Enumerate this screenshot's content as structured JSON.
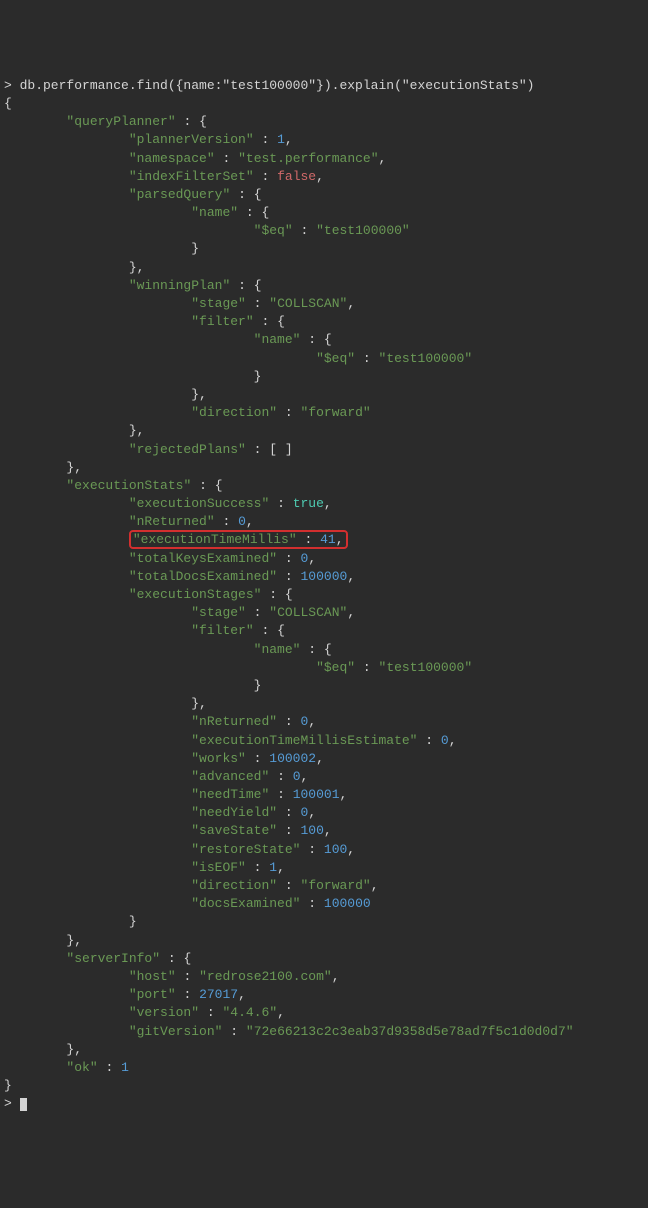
{
  "command_line": "> db.performance.find({name:\"test100000\"}).explain(\"executionStats\")",
  "queryPlanner": {
    "plannerVersion": 1,
    "namespace": "test.performance",
    "indexFilterSet": "false",
    "parsedQuery": {
      "name": {
        "$eq": "test100000"
      }
    },
    "winningPlan": {
      "stage": "COLLSCAN",
      "filter": {
        "name": {
          "$eq": "test100000"
        }
      },
      "direction": "forward"
    },
    "rejectedPlans": "[ ]"
  },
  "executionStats": {
    "executionSuccess": "true",
    "nReturned": 0,
    "executionTimeMillis": 41,
    "totalKeysExamined": 0,
    "totalDocsExamined": 100000,
    "executionStages": {
      "stage": "COLLSCAN",
      "filter": {
        "name": {
          "$eq": "test100000"
        }
      },
      "nReturned": 0,
      "executionTimeMillisEstimate": 0,
      "works": 100002,
      "advanced": 0,
      "needTime": 100001,
      "needYield": 0,
      "saveState": 100,
      "restoreState": 100,
      "isEOF": 1,
      "direction": "forward",
      "docsExamined": 100000
    }
  },
  "serverInfo": {
    "host": "redrose2100.com",
    "port": 27017,
    "version": "4.4.6",
    "gitVersion": "72e66213c2c3eab37d9358d5e78ad7f5c1d0d0d7"
  },
  "ok": 1,
  "prompt_end": "> "
}
